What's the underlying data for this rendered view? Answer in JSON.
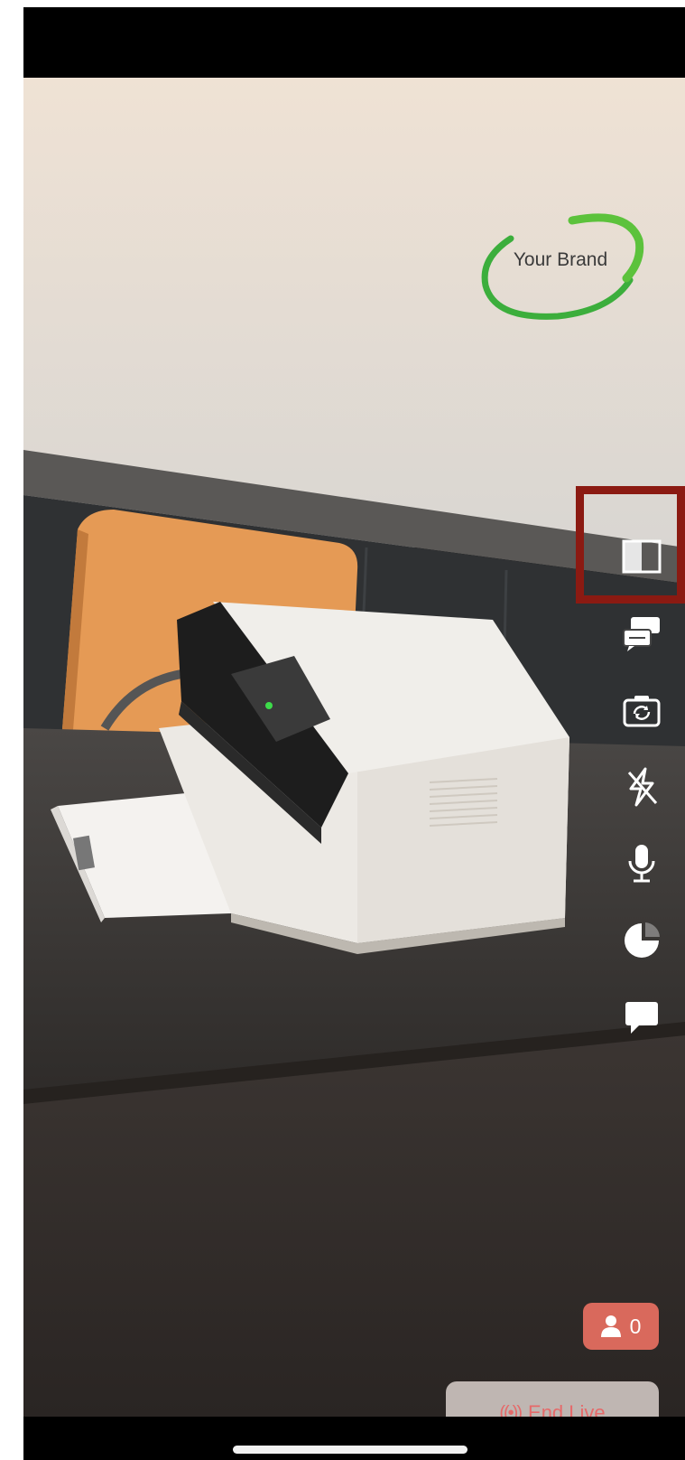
{
  "brand": {
    "text": "Your Brand"
  },
  "toolbar": {
    "items": [
      {
        "icon": "split-view-icon"
      },
      {
        "icon": "chat-toggle-icon"
      },
      {
        "icon": "camera-switch-icon"
      },
      {
        "icon": "flash-off-icon"
      },
      {
        "icon": "microphone-icon"
      },
      {
        "icon": "timer-pie-icon"
      },
      {
        "icon": "comment-icon"
      }
    ]
  },
  "viewers": {
    "count": "0",
    "icon": "person-icon"
  },
  "end_live": {
    "label": "End Live",
    "icon": "broadcast-icon",
    "glyph": "((•))"
  },
  "colors": {
    "highlight": "#8b1a12",
    "badge": "#d9695c",
    "end_live_text": "#e56a6a",
    "brand_ring": "#3cae3c"
  }
}
